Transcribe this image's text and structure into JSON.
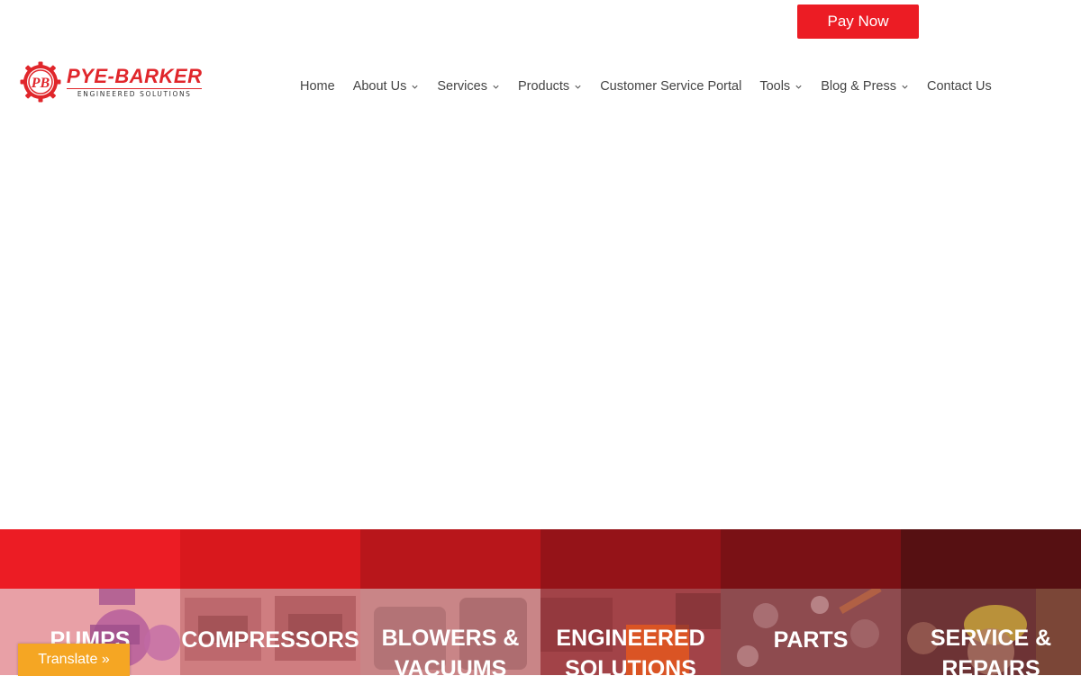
{
  "topbar": {
    "pay_now_label": "Pay Now"
  },
  "logo": {
    "title": "PYE-BARKER",
    "subtitle": "ENGINEERED SOLUTIONS",
    "monogram": "PB"
  },
  "nav": {
    "items": [
      {
        "label": "Home",
        "has_dropdown": false
      },
      {
        "label": "About Us",
        "has_dropdown": true
      },
      {
        "label": "Services",
        "has_dropdown": true
      },
      {
        "label": "Products",
        "has_dropdown": true
      },
      {
        "label": "Customer Service Portal",
        "has_dropdown": false
      },
      {
        "label": "Tools",
        "has_dropdown": true
      },
      {
        "label": "Blog & Press",
        "has_dropdown": true
      },
      {
        "label": "Contact Us",
        "has_dropdown": false
      }
    ]
  },
  "categories": [
    {
      "label": "PUMPS",
      "color": "#ec1c24",
      "tint": "#e8a0a6"
    },
    {
      "label": "COMPRESSORS",
      "color": "#d9181d",
      "tint": "#cf7d80"
    },
    {
      "label": "BLOWERS & VACUUMS",
      "color": "#b8161b",
      "tint": "#c98587"
    },
    {
      "label": "ENGINEERED SOLUTIONS",
      "color": "#951318",
      "tint": "#a24348"
    },
    {
      "label": "PARTS",
      "color": "#7a1115",
      "tint": "#8e4b4f"
    },
    {
      "label": "SERVICE & REPAIRS",
      "color": "#561012",
      "tint": "#6d3335"
    }
  ],
  "translate": {
    "label": "Translate »"
  },
  "colors": {
    "brand_red": "#ec1c24",
    "translate_orange": "#f5a623"
  }
}
